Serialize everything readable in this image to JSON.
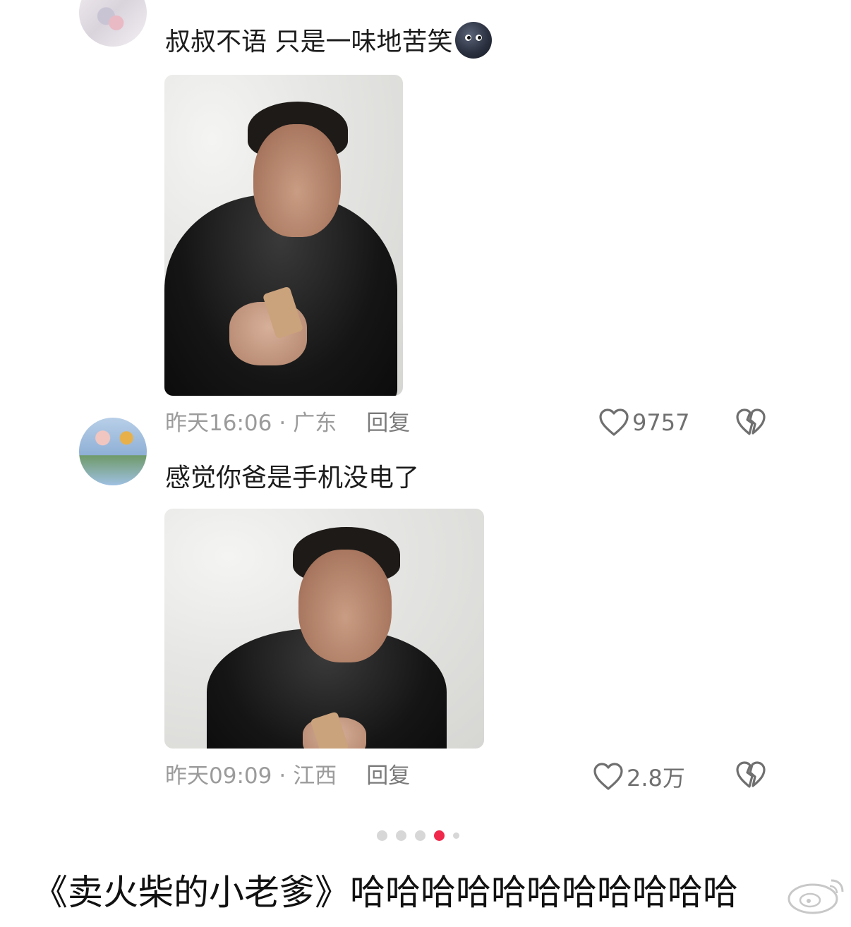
{
  "comments": [
    {
      "text": "叔叔不语 只是一味地苦笑",
      "emoji": "smirk-moon-emoji",
      "time": "昨天16:06",
      "separator": "·",
      "region": "广东",
      "reply_label": "回复",
      "likes": "9757"
    },
    {
      "text": "感觉你爸是手机没电了",
      "time": "昨天09:09",
      "separator": "·",
      "region": "江西",
      "reply_label": "回复",
      "likes": "2.8万"
    }
  ],
  "icons": {
    "like": "heart-outline-icon",
    "dislike": "broken-heart-icon"
  },
  "pager": {
    "total": 5,
    "active_index": 3
  },
  "caption": "《卖火柴的小老爹》哈哈哈哈哈哈哈哈哈哈哈",
  "colors": {
    "accent": "#f0284b",
    "meta": "#9b9b9b"
  }
}
